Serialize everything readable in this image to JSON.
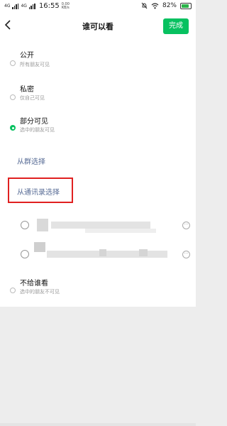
{
  "status_bar": {
    "signal_1": "4G",
    "signal_2": "4G",
    "time": "16:55",
    "speed_value": "0.00",
    "speed_unit": "KB/s",
    "battery": "82%"
  },
  "nav": {
    "title": "谁可以看",
    "done_label": "完成"
  },
  "options": {
    "public": {
      "label": "公开",
      "desc": "所有朋友可见",
      "selected": false
    },
    "private": {
      "label": "私密",
      "desc": "仅自己可见",
      "selected": false
    },
    "partial": {
      "label": "部分可见",
      "desc": "选中的朋友可见",
      "selected": true
    },
    "exclude": {
      "label": "不给谁看",
      "desc": "选中的朋友不可见",
      "selected": false
    }
  },
  "links": {
    "from_group": "从群选择",
    "from_contacts": "从通讯录选择"
  },
  "contacts": [
    {
      "name_hidden": true
    },
    {
      "name_hidden": true
    }
  ],
  "colors": {
    "accent_green": "#07c160",
    "link_blue": "#576b95",
    "highlight_red": "#e02020"
  }
}
